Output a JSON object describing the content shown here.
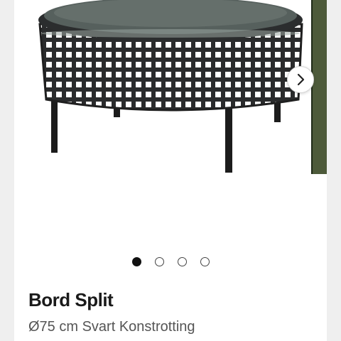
{
  "listing": {
    "title": "Bord Split",
    "subtitle": "Ø75 cm Svart Konstrotting"
  },
  "gallery": {
    "image_count": 4,
    "active_index": 0,
    "image_description": "Round black rattan coffee table with glass top",
    "next_icon": "chevron-right-icon"
  },
  "colors": {
    "background": "#ffffff",
    "side_panel": "#efefef",
    "dot_active": "#111111",
    "title": "#1a1a1a",
    "subtitle": "#555555"
  }
}
